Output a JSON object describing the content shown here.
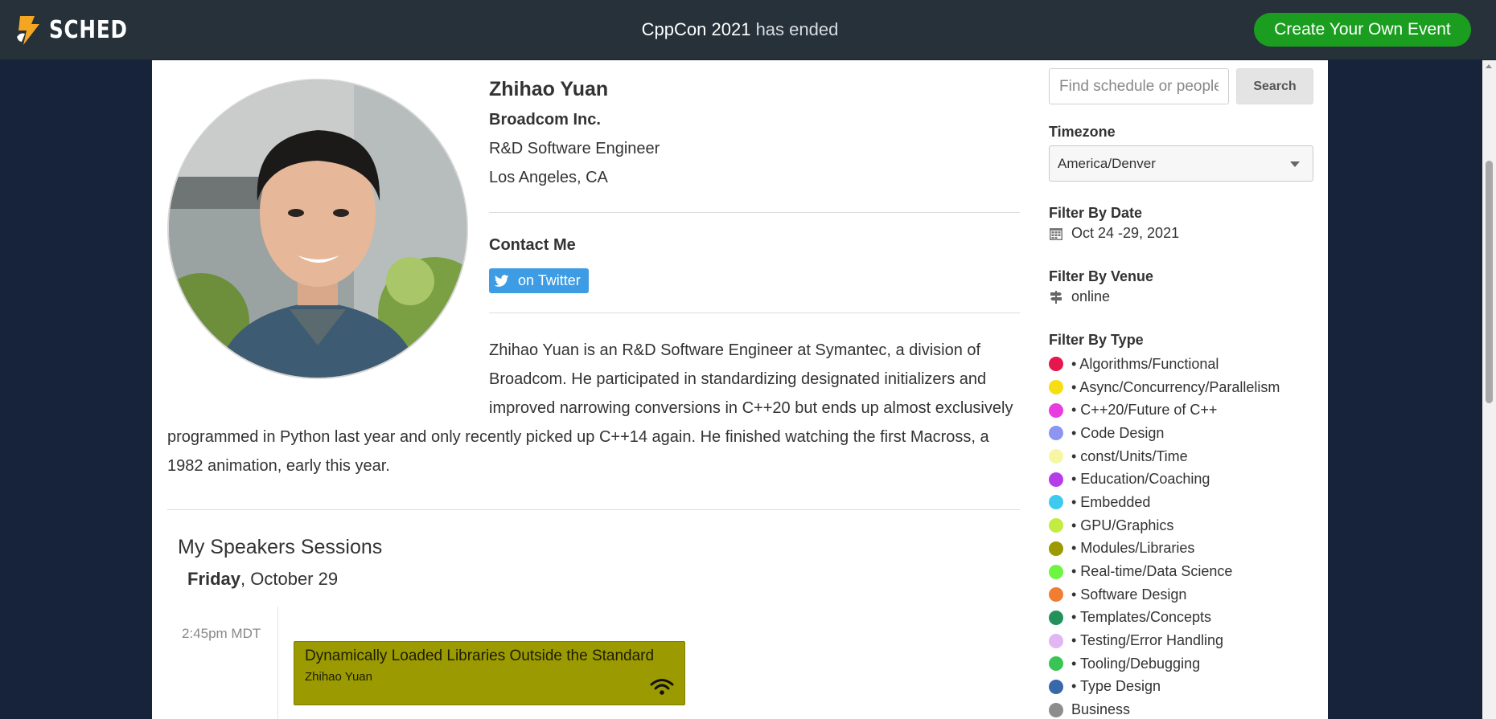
{
  "header": {
    "logo_text": "SCHED",
    "event_name": "CppCon 2021",
    "event_status": " has ended",
    "create_button": "Create Your Own Event"
  },
  "speaker": {
    "name": "Zhihao Yuan",
    "company": "Broadcom Inc.",
    "position": "R&D Software Engineer",
    "location": "Los Angeles, CA",
    "contact_heading": "Contact Me",
    "twitter_label": "on Twitter",
    "bio": "Zhihao Yuan is an R&D Software Engineer at Symantec, a division of Broadcom. He participated in standardizing designated initializers and improved narrowing conversions in C++20 but ends up almost exclusively programmed in Python last year and only recently picked up C++14 again. He finished watching the first Macross, a 1982 animation, early this year."
  },
  "sessions": {
    "heading": "My Speakers Sessions",
    "day_name": "Friday",
    "day_date": ", October 29",
    "time": "2:45pm MDT",
    "title": "Dynamically Loaded Libraries Outside the Standard",
    "speaker": "Zhihao Yuan",
    "color": "#9b9a00"
  },
  "sidebar": {
    "search_placeholder": "Find schedule or people",
    "search_button": "Search",
    "timezone_label": "Timezone",
    "timezone_value": "America/Denver",
    "date_label": "Filter By Date",
    "date_value": "Oct 24 -29, 2021",
    "venue_label": "Filter By Venue",
    "venue_value": "online",
    "type_label": "Filter By Type",
    "types": [
      {
        "label": "• Algorithms/Functional",
        "color": "#e6174c"
      },
      {
        "label": "• Async/Concurrency/Parallelism",
        "color": "#f5df13"
      },
      {
        "label": "• C++20/Future of C++",
        "color": "#e83ce0"
      },
      {
        "label": "• Code Design",
        "color": "#8c95f0"
      },
      {
        "label": "• const/Units/Time",
        "color": "#f6f7a5"
      },
      {
        "label": "• Education/Coaching",
        "color": "#b53ce8"
      },
      {
        "label": "• Embedded",
        "color": "#3ecaee"
      },
      {
        "label": "• GPU/Graphics",
        "color": "#c2ec42"
      },
      {
        "label": "• Modules/Libraries",
        "color": "#9b9a00"
      },
      {
        "label": "• Real-time/Data Science",
        "color": "#6ef541"
      },
      {
        "label": "• Software Design",
        "color": "#f07d31"
      },
      {
        "label": "• Templates/Concepts",
        "color": "#22915c"
      },
      {
        "label": "• Testing/Error Handling",
        "color": "#e2b5f5"
      },
      {
        "label": "• Tooling/Debugging",
        "color": "#39c454"
      },
      {
        "label": "• Type Design",
        "color": "#3768a8"
      },
      {
        "label": "Business",
        "color": "#8d8d8d"
      }
    ]
  }
}
